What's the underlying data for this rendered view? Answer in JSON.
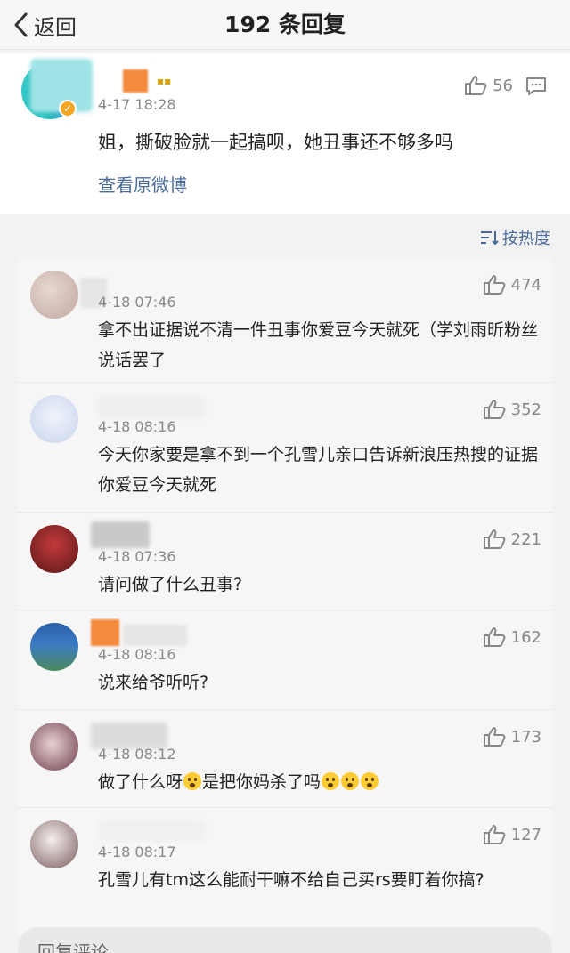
{
  "header": {
    "back_label": "返回",
    "title": "192 条回复"
  },
  "root_comment": {
    "timestamp": "4-17 18:28",
    "likes": "56",
    "text": "姐，撕破脸就一起搞呗，她丑事还不够多吗",
    "view_original": "查看原微博"
  },
  "sort": {
    "label": "按热度"
  },
  "replies": [
    {
      "timestamp": "4-18 07:46",
      "likes": "474",
      "text": "拿不出证据说不清一件丑事你爱豆今天就死（学刘雨昕粉丝说话罢了"
    },
    {
      "timestamp": "4-18 08:16",
      "likes": "352",
      "text": "今天你家要是拿不到一个孔雪儿亲口告诉新浪压热搜的证据 你爱豆今天就死"
    },
    {
      "timestamp": "4-18 07:36",
      "likes": "221",
      "text": "请问做了什么丑事?"
    },
    {
      "timestamp": "4-18 08:16",
      "likes": "162",
      "text": "说来给爷听听?"
    },
    {
      "timestamp": "4-18 08:12",
      "likes": "173",
      "text_a": "做了什么呀",
      "text_b": "是把你妈杀了吗"
    },
    {
      "timestamp": "4-18 08:17",
      "likes": "127",
      "text": "孔雪儿有tm这么能耐干嘛不给自己买rs要盯着你搞?"
    }
  ],
  "input": {
    "placeholder": "回复评论"
  },
  "colors": {
    "link": "#4a6b9a",
    "muted": "#888888"
  }
}
